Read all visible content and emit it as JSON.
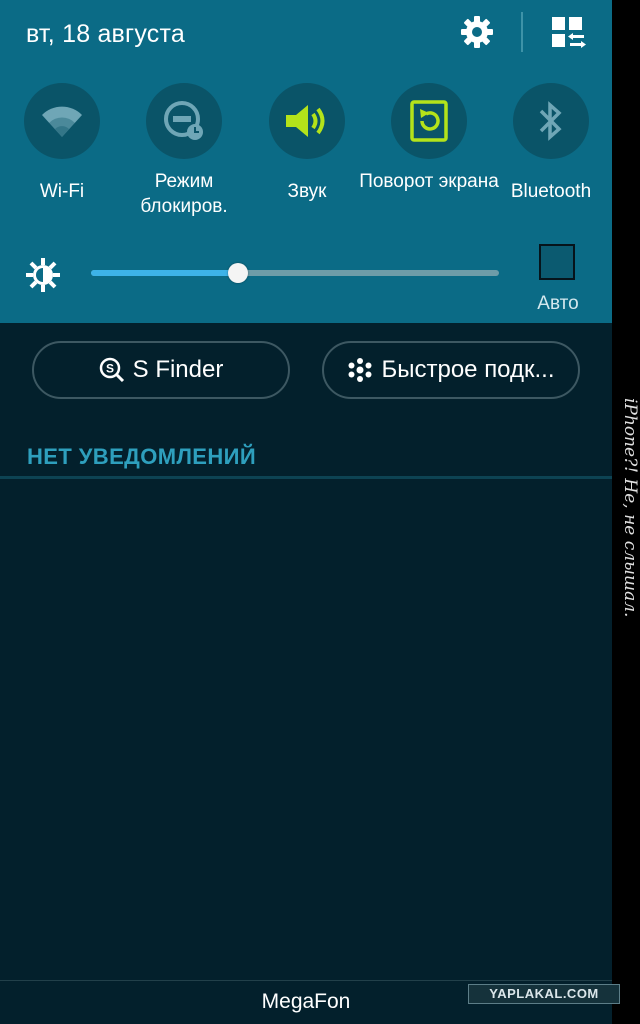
{
  "status": {
    "date": "вт, 18 августа",
    "settings_icon": "gear-icon",
    "edit_icon": "grid-edit-icon"
  },
  "quick_toggles": [
    {
      "label": "Wi-Fi",
      "icon": "wifi-icon",
      "active": false
    },
    {
      "label": "Режим блокиров.",
      "icon": "blocking-mode-icon",
      "active": false
    },
    {
      "label": "Звук",
      "icon": "sound-icon",
      "active": true
    },
    {
      "label": "Поворот экрана",
      "icon": "rotate-screen-icon",
      "active": true
    },
    {
      "label": "Bluetooth",
      "icon": "bluetooth-icon",
      "active": false
    }
  ],
  "brightness": {
    "level": 0.36,
    "auto_label": "Авто",
    "auto_checked": false
  },
  "buttons": {
    "s_finder": "S Finder",
    "quick_connect": "Быстрое подк..."
  },
  "notifications": {
    "empty_label": "НЕТ УВЕДОМЛЕНИЙ"
  },
  "footer": {
    "carrier": "MegaFon"
  },
  "overlay": {
    "side_note": "iPhone?! Не, не слышал.",
    "watermark": "YAPLAKAL.COM"
  },
  "colors": {
    "panel_top": "#0b6b86",
    "panel_bg": "#03202c",
    "active_icon": "#b4e31a",
    "inactive_icon": "#6fa6b6",
    "slider_fill": "#3db3e8",
    "header_text": "#2e9fbd"
  }
}
